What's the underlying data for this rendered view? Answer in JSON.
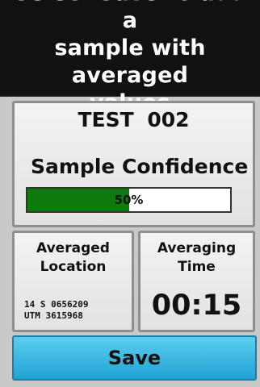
{
  "header": {
    "instruction": "Select Save to add a\nsample with averaged\nvalues"
  },
  "sample": {
    "name": "TEST 002",
    "confidence_label": "Sample Confidence",
    "confidence_percent": 50,
    "confidence_text": "50%",
    "fill_color": "#0d7a0d"
  },
  "averaged_location": {
    "title": "Averaged\nLocation",
    "line1": "14 S 0656209",
    "line2": "UTM 3615968"
  },
  "averaging_time": {
    "title": "Averaging\nTime",
    "value": "00:15"
  },
  "save_button": {
    "label": "Save",
    "color": "#21a3d4"
  }
}
